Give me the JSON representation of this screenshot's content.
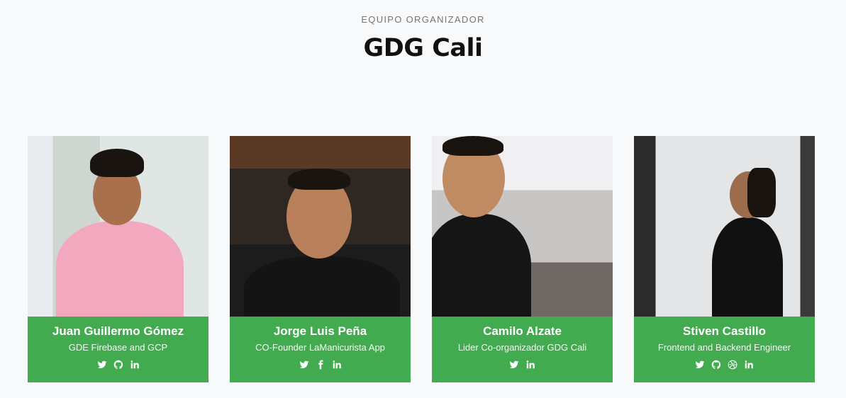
{
  "header": {
    "eyebrow": "EQUIPO ORGANIZADOR",
    "title": "GDG Cali"
  },
  "colors": {
    "card_accent": "#43ab4f",
    "background": "#f8f9fb"
  },
  "members": [
    {
      "name": "Juan Guillermo Gómez",
      "role": "GDE Firebase and GCP",
      "social": [
        "twitter-icon",
        "github-icon",
        "linkedin-icon"
      ]
    },
    {
      "name": "Jorge Luis Peña",
      "role": "CO-Founder LaManicurista App",
      "social": [
        "twitter-icon",
        "facebook-icon",
        "linkedin-icon"
      ]
    },
    {
      "name": "Camilo Alzate",
      "role": "Lider Co-organizador GDG Cali",
      "social": [
        "twitter-icon",
        "linkedin-icon"
      ]
    },
    {
      "name": "Stiven Castillo",
      "role": "Frontend and Backend Engineer",
      "social": [
        "twitter-icon",
        "github-icon",
        "dribbble-icon",
        "linkedin-icon"
      ]
    }
  ]
}
